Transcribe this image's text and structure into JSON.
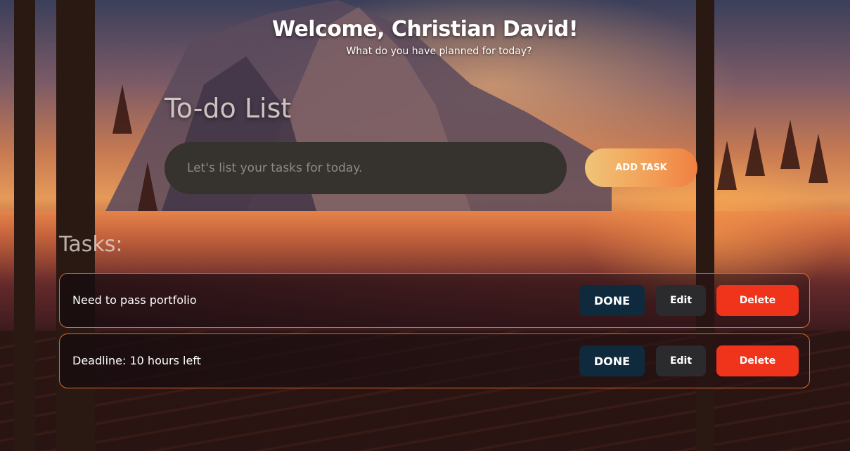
{
  "header": {
    "title": "Welcome, Christian David!",
    "subtitle": "What do you have planned for today?"
  },
  "todo": {
    "title": "To-do List",
    "input_placeholder": "Let's list your tasks for today.",
    "input_value": "",
    "add_label": "ADD TASK"
  },
  "tasks_section": {
    "label": "Tasks:",
    "items": [
      {
        "text": "Need to pass portfolio",
        "done_label": "DONE",
        "edit_label": "Edit",
        "delete_label": "Delete"
      },
      {
        "text": "Deadline: 10 hours left",
        "done_label": "DONE",
        "edit_label": "Edit",
        "delete_label": "Delete"
      }
    ]
  },
  "colors": {
    "input_bg": "#36322d",
    "add_gradient_start": "#f0c478",
    "add_gradient_end": "#f08043",
    "done_bg": "#0f2a3c",
    "edit_bg": "#2b2a2c",
    "delete_bg": "#f0341c",
    "task_border": "#e0692e"
  }
}
